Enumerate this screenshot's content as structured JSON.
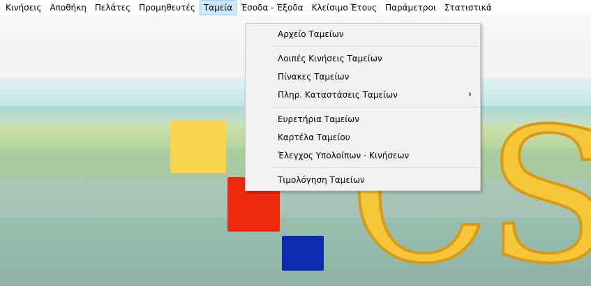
{
  "menubar": {
    "items": [
      {
        "label": "Κινήσεις"
      },
      {
        "label": "Αποθήκη"
      },
      {
        "label": "Πελάτες"
      },
      {
        "label": "Προμηθευτές"
      },
      {
        "label": "Ταμεία",
        "active": true
      },
      {
        "label": "Έσοδα - Έξοδα"
      },
      {
        "label": "Κλείσιμο Έτους"
      },
      {
        "label": "Παράμετροι"
      },
      {
        "label": "Στατιστικά"
      }
    ]
  },
  "dropdown": {
    "groups": [
      [
        {
          "label": "Αρχείο Ταμείων"
        }
      ],
      [
        {
          "label": "Λοιπές Κινήσεις Ταμείων"
        },
        {
          "label": "Πίνακες Ταμείων"
        },
        {
          "label": "Πληρ. Καταστάσεις Ταμείων",
          "submenu_arrow": "›"
        }
      ],
      [
        {
          "label": "Ευρετήρια Ταμείων"
        },
        {
          "label": "Καρτέλα Ταμείου"
        },
        {
          "label": "Έλεγχος Υπολοίπων - Κινήσεων"
        }
      ],
      [
        {
          "label": "Τιμολόγηση Ταμείων"
        }
      ]
    ]
  },
  "splash": {
    "logo_text": "CS",
    "colors": {
      "yellow_square": "#f9d44d",
      "red_square": "#ee2a0e",
      "blue_square": "#0e2bb0",
      "logo_text": "#f5c63a",
      "menu_highlight": "#cce8ff"
    }
  }
}
